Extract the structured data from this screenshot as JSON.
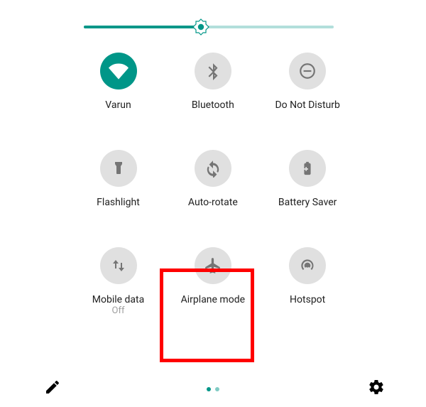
{
  "slider": {
    "percent": 47
  },
  "tiles": [
    {
      "label": "Varun",
      "sublabel": ""
    },
    {
      "label": "Bluetooth",
      "sublabel": ""
    },
    {
      "label": "Do Not Disturb",
      "sublabel": ""
    },
    {
      "label": "Flashlight",
      "sublabel": ""
    },
    {
      "label": "Auto-rotate",
      "sublabel": ""
    },
    {
      "label": "Battery Saver",
      "sublabel": ""
    },
    {
      "label": "Mobile data",
      "sublabel": "Off"
    },
    {
      "label": "Airplane mode",
      "sublabel": ""
    },
    {
      "label": "Hotspot",
      "sublabel": ""
    }
  ],
  "colors": {
    "accent": "#009688",
    "inactive_icon_bg": "#e0e0e0",
    "icon_fg": "#757575",
    "highlight": "#ff0000"
  },
  "highlight_tile_index": 7,
  "page_indicator": {
    "count": 2,
    "active": 0
  }
}
